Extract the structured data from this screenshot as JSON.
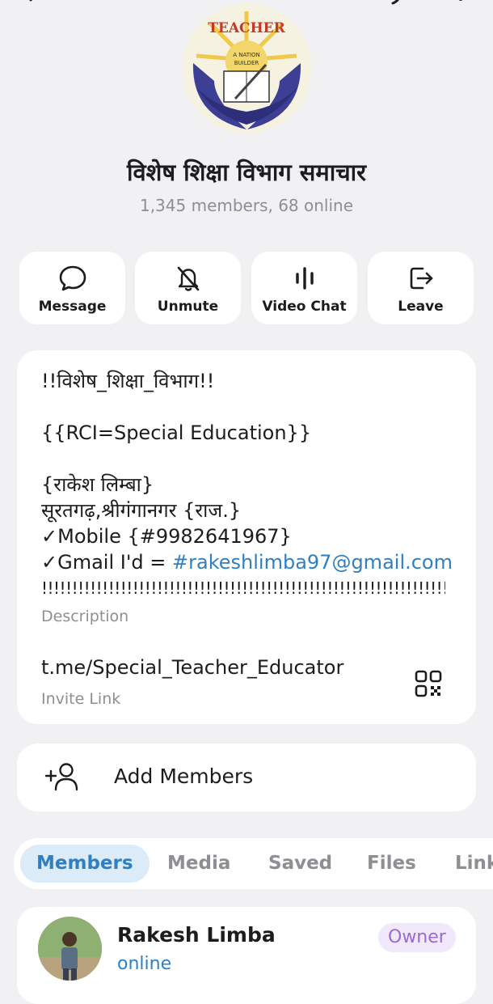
{
  "group": {
    "name": "विशेष शिक्षा विभाग समाचार",
    "stats": "1,345 members, 68 online",
    "avatar_icon": "teacher-nation-builder-logo",
    "avatar_logo_text": {
      "top": "TEACHER",
      "line1": "A NATION",
      "line2": "BUILDER"
    }
  },
  "actions": [
    {
      "label": "Message",
      "icon": "message-bubble-icon"
    },
    {
      "label": "Unmute",
      "icon": "bell-off-icon"
    },
    {
      "label": "Video Chat",
      "icon": "audio-bars-icon"
    },
    {
      "label": "Leave",
      "icon": "exit-icon"
    }
  ],
  "info": {
    "description_lines": {
      "l1": "!!विशेष_शिक्षा_विभाग!!",
      "l2": "{{RCI=Special Education}}",
      "l3": "{राकेश लिम्बा}",
      "l4": "सूरतगढ़,श्रीगंगानगर {राज.}",
      "l5": "✓Mobile {#9982641967}",
      "l6_prefix": "✓Gmail I'd = ",
      "l6_link": "#rakeshlimba97@gmail.com",
      "l7": "!!!!!!!!!!!!!!!!!!!!!!!!!!!!!!!!!!!!!!!!!!!!!!!!!!!!!!!!!!!!!!!!!!!!!!"
    },
    "description_label": "Description",
    "invite_link": "t.me/Special_Teacher_Educator",
    "invite_label": "Invite Link",
    "qr_icon": "qr-code-icon"
  },
  "add_members": {
    "label": "Add Members",
    "icon": "add-person-icon"
  },
  "tabs": [
    {
      "label": "Members",
      "active": true
    },
    {
      "label": "Media"
    },
    {
      "label": "Saved"
    },
    {
      "label": "Files"
    },
    {
      "label": "Links"
    }
  ],
  "members": [
    {
      "name": "Rakesh Limba",
      "status": "online",
      "role": "Owner"
    }
  ],
  "colors": {
    "accent": "#2f7fc1",
    "background": "#f1f1f4",
    "card": "#ffffff",
    "owner_badge_bg": "#f1e8fb",
    "owner_badge_text": "#9a6ad6"
  }
}
